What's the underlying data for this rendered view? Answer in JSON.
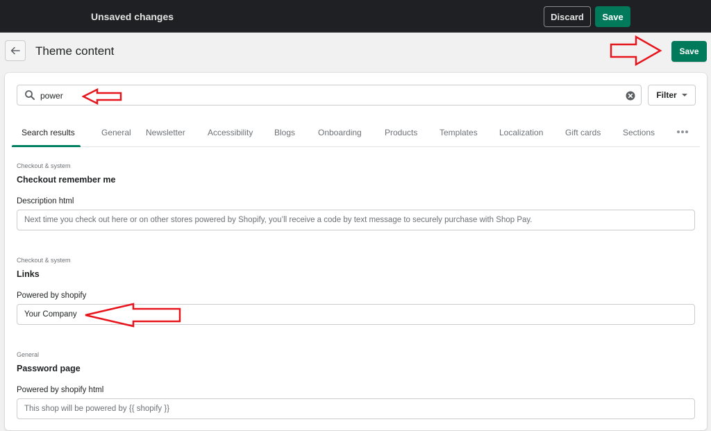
{
  "topbar": {
    "status": "Unsaved changes",
    "discard_label": "Discard",
    "save_label": "Save"
  },
  "header": {
    "back_icon": "arrow-left-icon",
    "title": "Theme content",
    "save_label": "Save"
  },
  "search": {
    "icon": "search-icon",
    "value": "power",
    "clear_icon": "clear-circle-x-icon",
    "filter_label": "Filter",
    "filter_icon": "caret-down-icon"
  },
  "tabs": [
    {
      "label": "Search results",
      "active": true
    },
    {
      "label": "General",
      "active": false
    },
    {
      "label": "Newsletter",
      "active": false
    },
    {
      "label": "Accessibility",
      "active": false
    },
    {
      "label": "Blogs",
      "active": false
    },
    {
      "label": "Onboarding",
      "active": false
    },
    {
      "label": "Products",
      "active": false
    },
    {
      "label": "Templates",
      "active": false
    },
    {
      "label": "Localization",
      "active": false
    },
    {
      "label": "Gift cards",
      "active": false
    },
    {
      "label": "Sections",
      "active": false
    }
  ],
  "more_tabs_icon": "ellipsis-horizontal-icon",
  "accent_color": "#008060",
  "sections": [
    {
      "category": "Checkout & system",
      "title": "Checkout remember me",
      "field_label": "Description html",
      "value": "",
      "placeholder": "Next time you check out here or on other stores powered by Shopify, you’ll receive a code by text message to securely purchase with Shop Pay."
    },
    {
      "category": "Checkout & system",
      "title": "Links",
      "field_label": "Powered by shopify",
      "value": "Your Company",
      "placeholder": ""
    },
    {
      "category": "General",
      "title": "Password page",
      "field_label": "Powered by shopify html",
      "value": "",
      "placeholder": "This shop will be powered by {{ shopify }}"
    }
  ],
  "annotations": {
    "arrow_color": "#e8141c"
  }
}
